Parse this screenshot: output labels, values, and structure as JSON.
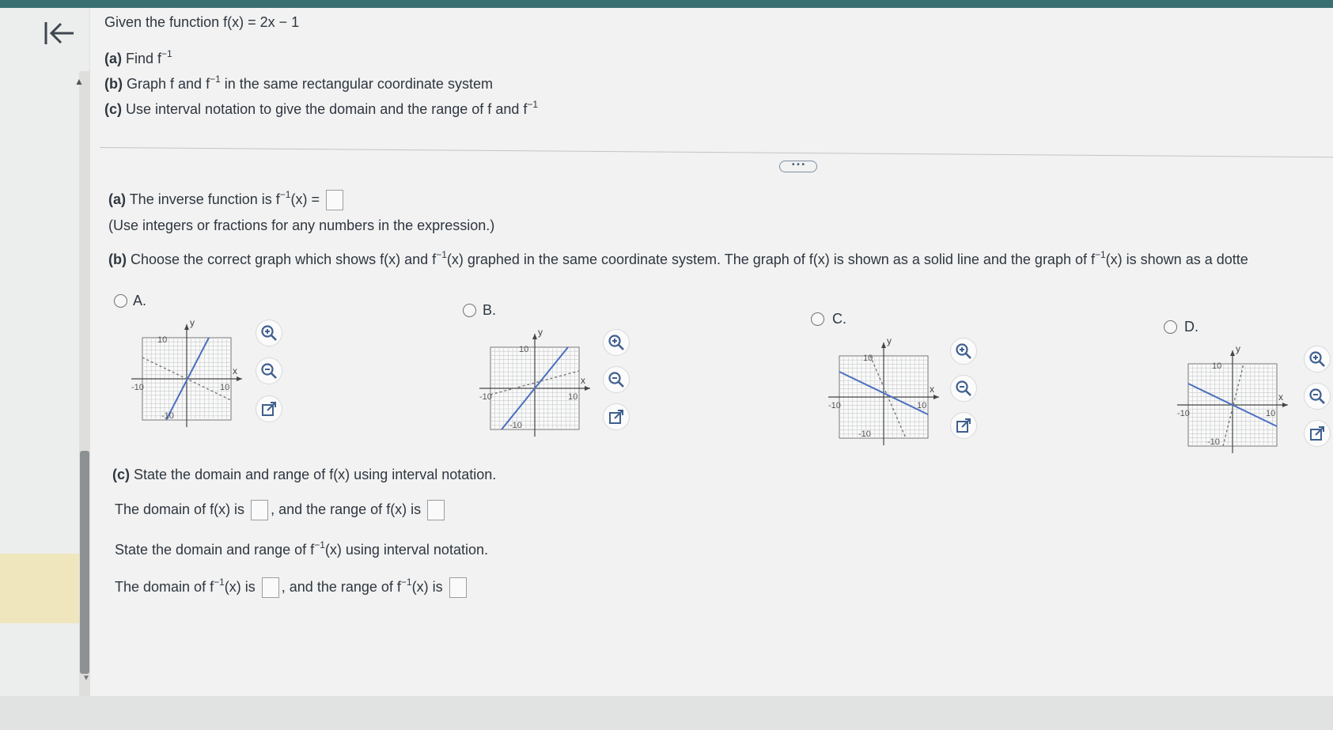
{
  "question": {
    "intro_prefix": "Given the function ",
    "intro_func": "f(x) = 2x − 1",
    "a_label": "(a)",
    "a_text": "Find f",
    "b_label": "(b)",
    "b_text_1": "Graph f and f",
    "b_text_2": "in the same rectangular coordinate system",
    "c_label": "(c)",
    "c_text_1": "Use interval notation to give the domain and the range of f and f",
    "inverse_sup": "−1"
  },
  "more_button": "• • •",
  "answer": {
    "a_label": "(a)",
    "a_text": "The inverse function is f",
    "a_text_2": "(x) =",
    "a_hint": "(Use integers or fractions for any numbers in the expression.)",
    "b_label": "(b)",
    "b_text_1": "Choose the correct graph which shows f(x) and f",
    "b_text_2": "(x) graphed in the same coordinate system. The graph of f(x) is shown as a solid line and the graph of f",
    "b_text_3": "(x) is shown as a dotte",
    "c_label": "(c)",
    "c_text": "State the domain and range of f(x) using interval notation.",
    "domain_f_1": "The domain of f(x) is",
    "domain_f_2": ", and the range of f(x) is",
    "inv_prompt_1": "State the domain and range of f",
    "inv_prompt_2": "(x) using interval notation.",
    "domain_inv_1": "The domain of f",
    "domain_inv_2": "(x) is",
    "domain_inv_3": ", and the range of f",
    "domain_inv_4": "(x) is"
  },
  "options": [
    {
      "letter": "A."
    },
    {
      "letter": "B."
    },
    {
      "letter": "C."
    },
    {
      "letter": "D."
    }
  ],
  "graph_labels": {
    "y": "y",
    "x": "x",
    "pos": "10",
    "neg": "-10"
  },
  "icons": {
    "back": "back-to-start-icon",
    "zoom_in": "zoom-in-icon",
    "zoom_out": "zoom-out-icon",
    "popout": "open-external-icon"
  }
}
